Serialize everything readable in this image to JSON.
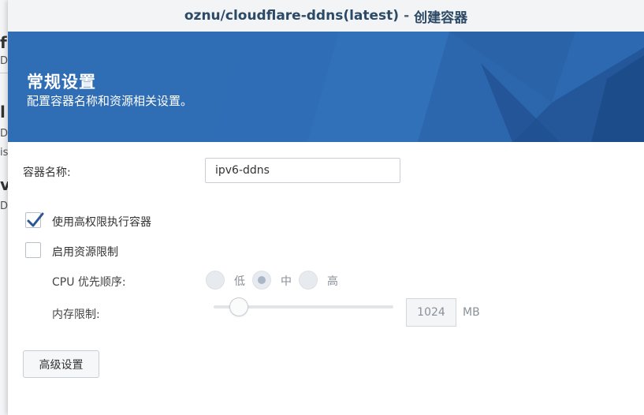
{
  "background_window": {
    "fragments": [
      "f",
      "D",
      "l",
      "D",
      "is",
      "v",
      "D"
    ]
  },
  "dialog": {
    "title_image": "oznu/cloudflare-ddns(latest)",
    "title_separator": "-",
    "title_action": "创建容器"
  },
  "banner": {
    "title": "常规设置",
    "subtitle": "配置容器名称和资源相关设置。"
  },
  "form": {
    "container_name_label": "容器名称:",
    "container_name_value": "ipv6-ddns",
    "privileged_label": "使用高权限执行容器",
    "privileged_checked": true,
    "resource_limit_label": "启用资源限制",
    "resource_limit_checked": false,
    "cpu_priority_label": "CPU 优先顺序:",
    "cpu_options": [
      {
        "label": "低",
        "selected": false
      },
      {
        "label": "中",
        "selected": true
      },
      {
        "label": "高",
        "selected": false
      }
    ],
    "memory_label": "内存限制:",
    "memory_value": "1024",
    "memory_unit": "MB",
    "memory_slider_fraction": 0.1,
    "advanced_button": "高级设置"
  },
  "colors": {
    "banner_blue": "#2f6db5",
    "check_blue": "#2b5797",
    "title_text": "#2c4a66"
  },
  "icons": {
    "checkmark": "check-icon"
  }
}
